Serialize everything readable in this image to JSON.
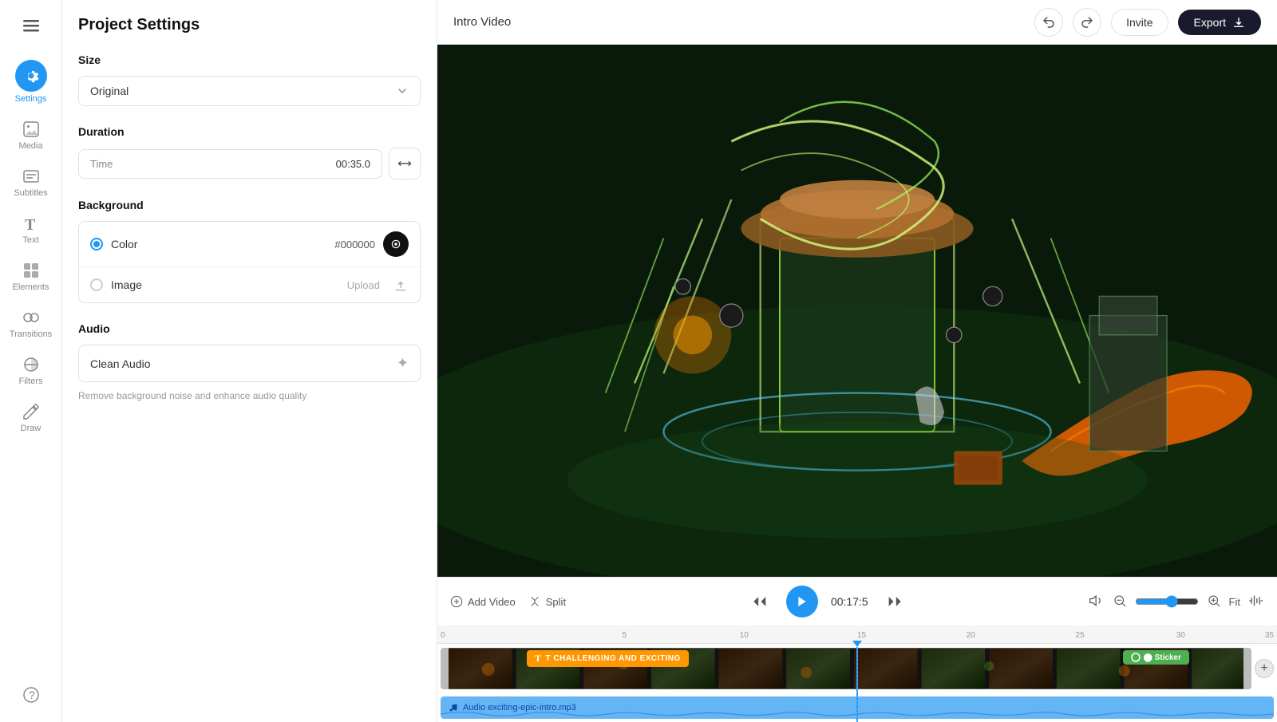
{
  "app": {
    "project_title": "Intro Video",
    "hamburger_label": "☰"
  },
  "sidebar": {
    "items": [
      {
        "id": "settings",
        "label": "Settings",
        "icon": "⚙",
        "active": true
      },
      {
        "id": "media",
        "label": "Media",
        "icon": "+"
      },
      {
        "id": "subtitles",
        "label": "Subtitles",
        "icon": "▤"
      },
      {
        "id": "text",
        "label": "Text",
        "icon": "T"
      },
      {
        "id": "elements",
        "label": "Elements",
        "icon": "◈"
      },
      {
        "id": "transitions",
        "label": "Transitions",
        "icon": "⬤"
      },
      {
        "id": "filters",
        "label": "Filters",
        "icon": "◑"
      },
      {
        "id": "draw",
        "label": "Draw",
        "icon": "✏"
      }
    ]
  },
  "settings_panel": {
    "title": "Project Settings",
    "size": {
      "label": "Size",
      "value": "Original",
      "placeholder": "Original"
    },
    "duration": {
      "label": "Duration",
      "time_label": "Time",
      "time_value": "00:35.0"
    },
    "background": {
      "label": "Background",
      "color_option": {
        "label": "Color",
        "value": "#000000",
        "active": true
      },
      "image_option": {
        "label": "Image",
        "upload_label": "Upload",
        "active": false
      }
    },
    "audio": {
      "label": "Audio",
      "clean_audio_label": "Clean Audio",
      "description": "Remove background noise and enhance audio quality"
    }
  },
  "topbar": {
    "undo_title": "Undo",
    "redo_title": "Redo",
    "invite_label": "Invite",
    "export_label": "Export"
  },
  "timeline": {
    "add_video_label": "Add Video",
    "split_label": "Split",
    "time_display": "00:17:5",
    "fit_label": "Fit",
    "ruler_marks": [
      "0",
      "5",
      "10",
      "15",
      "20",
      "25",
      "30",
      "35"
    ],
    "text_badge": "T  CHALLENGING AND EXCITING",
    "sticker_badge": "⬤  Sticker",
    "audio_track_label": "Audio exciting-epic-intro.mp3",
    "zoom_value": 60
  }
}
